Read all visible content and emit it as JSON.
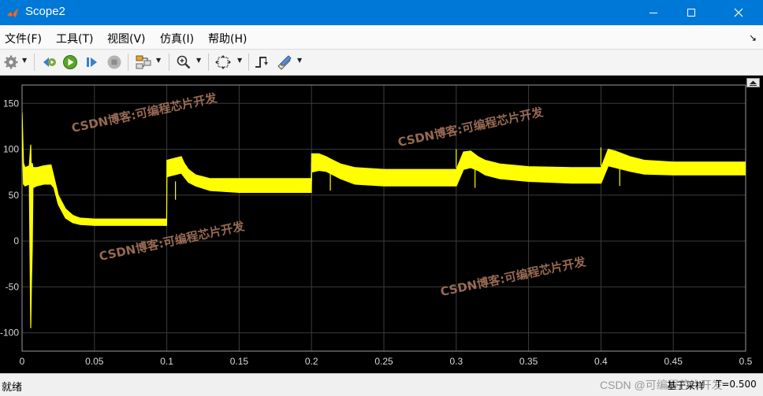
{
  "window": {
    "title": "Scope2"
  },
  "menu": [
    "文件(F)",
    "工具(T)",
    "视图(V)",
    "仿真(I)",
    "帮助(H)"
  ],
  "chart_data": {
    "type": "line",
    "title": "",
    "xlabel": "",
    "ylabel": "",
    "xlim": [
      0,
      0.5
    ],
    "ylim": [
      -120,
      170
    ],
    "x_ticks": [
      "0",
      "0.05",
      "0.1",
      "0.15",
      "0.2",
      "0.25",
      "0.3",
      "0.35",
      "0.4",
      "0.45",
      "0.5"
    ],
    "y_ticks": [
      "150",
      "100",
      "50",
      "0",
      "-50",
      "-100"
    ],
    "grid": true,
    "series": [
      {
        "color": "#ffff00",
        "x": [
          0,
          0.001,
          0.002,
          0.005,
          0.006,
          0.0065,
          0.007,
          0.0075,
          0.01,
          0.015,
          0.02,
          0.022,
          0.025,
          0.03,
          0.035,
          0.04,
          0.05,
          0.06,
          0.08,
          0.0999,
          0.1001,
          0.105,
          0.11,
          0.112,
          0.115,
          0.12,
          0.13,
          0.15,
          0.18,
          0.1999,
          0.2001,
          0.205,
          0.21,
          0.215,
          0.22,
          0.23,
          0.25,
          0.28,
          0.2999,
          0.3001,
          0.305,
          0.31,
          0.315,
          0.32,
          0.33,
          0.35,
          0.38,
          0.3999,
          0.4001,
          0.405,
          0.41,
          0.415,
          0.42,
          0.43,
          0.45,
          0.48,
          0.5
        ],
        "upper": [
          140,
          85,
          80,
          82,
          105,
          70,
          85,
          80,
          80,
          82,
          83,
          70,
          50,
          35,
          28,
          25,
          24,
          24,
          24,
          24,
          88,
          90,
          92,
          85,
          78,
          72,
          68,
          68,
          68,
          68,
          95,
          95,
          92,
          88,
          84,
          80,
          78,
          78,
          78,
          78,
          97,
          98,
          92,
          88,
          84,
          81,
          80,
          80,
          80,
          100,
          98,
          95,
          92,
          88,
          86,
          86,
          86
        ],
        "lower": [
          120,
          62,
          60,
          62,
          -95,
          -45,
          -10,
          58,
          60,
          62,
          62,
          58,
          40,
          25,
          20,
          18,
          17,
          17,
          17,
          17,
          70,
          72,
          74,
          70,
          64,
          60,
          55,
          53,
          53,
          53,
          75,
          77,
          76,
          72,
          68,
          62,
          60,
          60,
          60,
          60,
          78,
          80,
          77,
          72,
          68,
          65,
          63,
          63,
          63,
          82,
          80,
          78,
          76,
          73,
          72,
          72,
          72
        ],
        "spikes": [
          [
            0.106,
            45
          ],
          [
            0.2,
            65
          ],
          [
            0.213,
            55
          ],
          [
            0.3,
            80
          ],
          [
            0.313,
            58
          ],
          [
            0.4,
            82
          ],
          [
            0.413,
            60
          ]
        ]
      }
    ]
  },
  "watermarks": [
    "CSDN博客:可编程芯片开发",
    "CSDN博客:可编程芯片开发",
    "CSDN博客:可编程芯片开发",
    "CSDN博客:可编程芯片开发"
  ],
  "status": {
    "left": "就绪",
    "mode": "基于采样",
    "time": "T=0.500"
  },
  "attribution": "CSDN @可编程芯片开发",
  "colors": {
    "titlebar": "#0078d7",
    "plot_bg": "#000000",
    "trace": "#ffff00",
    "axes_text": "#d9d9d9",
    "grid": "#3c3c3c"
  },
  "icons": [
    "settings-icon",
    "step-back-icon",
    "run-icon",
    "step-forward-icon",
    "stop-icon",
    "highlight-icon",
    "zoom-icon",
    "fit-view-icon",
    "triggers-icon",
    "measure-icon"
  ]
}
